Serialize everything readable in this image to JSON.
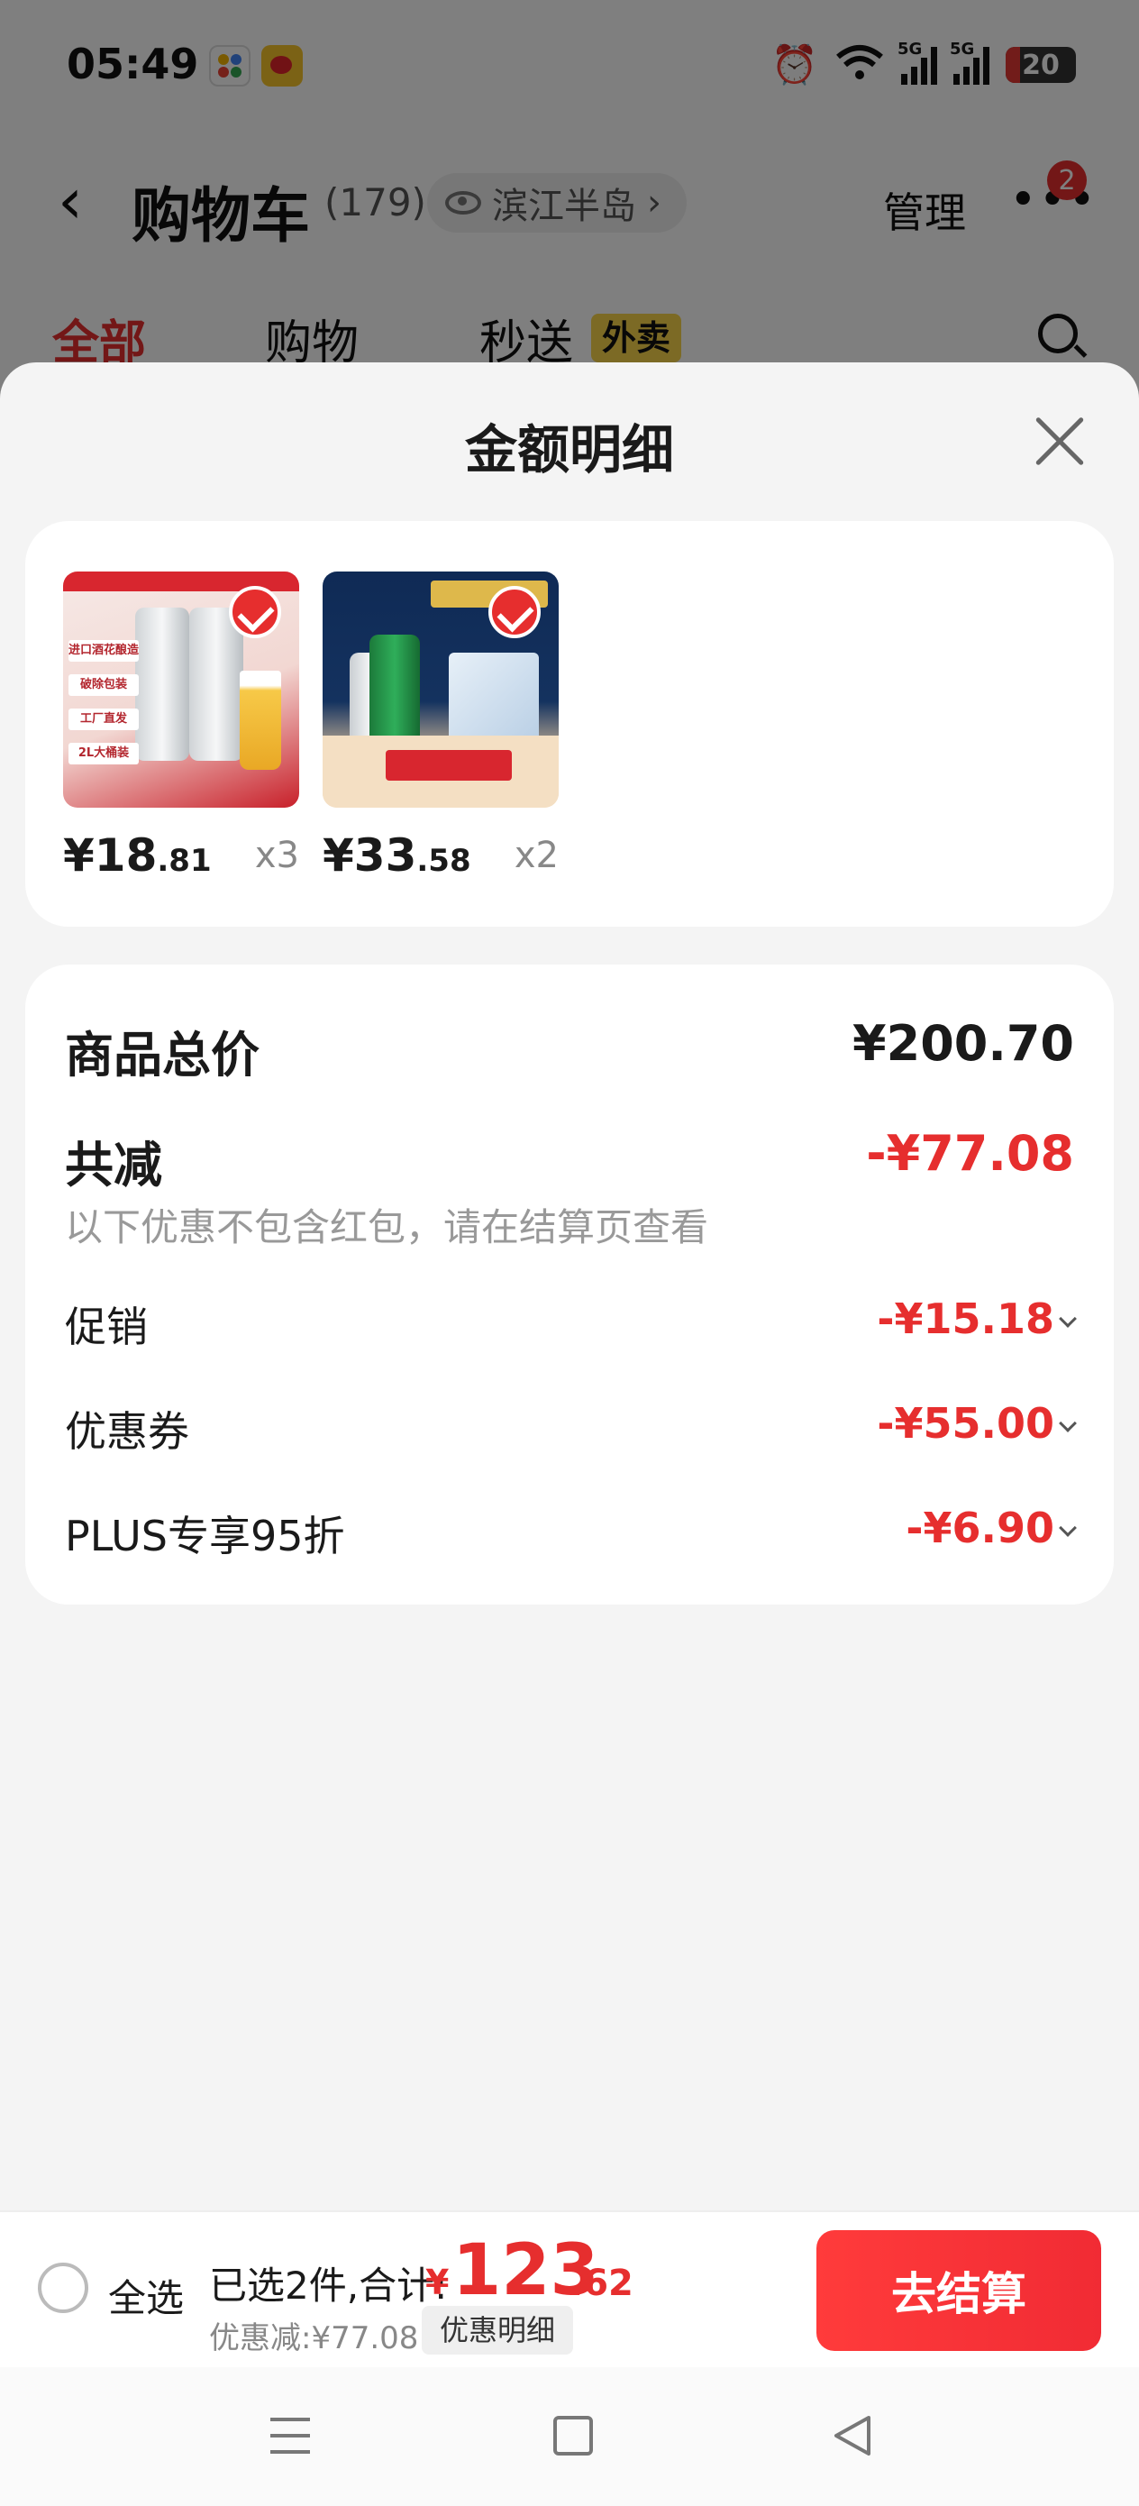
{
  "status_bar": {
    "time": "05:49",
    "network_label_1": "5G",
    "network_label_2": "5G",
    "battery": "20"
  },
  "nav": {
    "title": "购物车",
    "count": "(179)",
    "location": "滨江半岛",
    "manage": "管理",
    "more_badge": "2"
  },
  "tabs": [
    {
      "label": "全部"
    },
    {
      "label": "购物"
    },
    {
      "label": "秒送"
    }
  ],
  "tab_badge": "外卖",
  "sheet": {
    "title": "金额明细",
    "products": [
      {
        "price_int": "¥18",
        "price_dec": ".81",
        "qty": "x3"
      },
      {
        "price_int": "¥33",
        "price_dec": ".58",
        "qty": "x2"
      }
    ],
    "product_image_texts": {
      "p1": [
        "进口酒花酿造",
        "破除包装",
        "工厂直发",
        "2L大桶装"
      ]
    },
    "summary": {
      "total_label": "商品总价",
      "total_value": "¥200.70",
      "reduce_label": "共减",
      "reduce_value": "-¥77.08",
      "note": "以下优惠不包含红包，请在结算页查看",
      "items": [
        {
          "label": "促销",
          "value": "-¥15.18"
        },
        {
          "label": "优惠券",
          "value": "-¥55.00"
        },
        {
          "label": "PLUS专享95折",
          "value": "-¥6.90"
        }
      ]
    }
  },
  "checkout": {
    "select_all": "全选",
    "selected_info": "已选2件,合计:",
    "currency": "¥",
    "amount_int": "123",
    "amount_dec": ".62",
    "discount_info": "优惠减:¥77.08",
    "discount_detail_button": "优惠明细",
    "checkout_button": "去结算"
  },
  "colors": {
    "accent": "#e62e2e",
    "badge_yellow": "#f8d54a",
    "sheet_bg": "#f4f4f4"
  }
}
